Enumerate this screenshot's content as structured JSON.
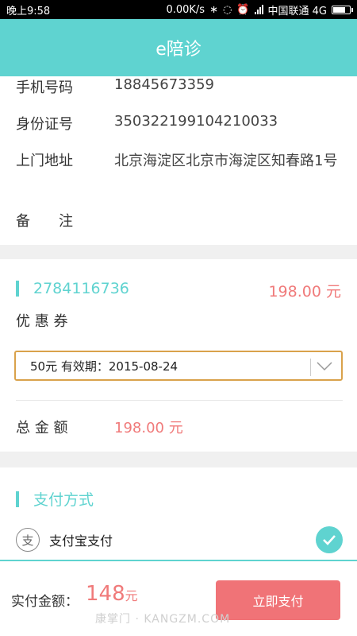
{
  "status_bar": {
    "time": "晚上9:58",
    "speed": "0.00K/s",
    "carrier": "中国联通 4G",
    "battery_level": 0.8
  },
  "header": {
    "title": "e陪诊"
  },
  "patient": {
    "phone_label": "手机号码",
    "phone_value": "18845673359",
    "id_label": "身份证号",
    "id_value": "350322199104210033",
    "address_label": "上门地址",
    "address_value": "北京海淀区北京市海淀区知春路1号",
    "remark_label": "备　　注"
  },
  "order": {
    "order_id": "2784116736",
    "price": "198.00 元",
    "coupon_label": "优 惠 券",
    "coupon_selected": "50元 有效期：2015-08-24",
    "total_label": "总 金 额",
    "total_value": "198.00 元"
  },
  "payment": {
    "section_title": "支付方式",
    "method_label": "支付宝支付",
    "method_icon": "alipay-icon",
    "method_selected": true
  },
  "footer": {
    "actual_label": "实付金额：",
    "actual_amount": "148",
    "actual_unit": "元",
    "pay_button": "立即支付",
    "watermark": "康掌门 · KANGZM.COM"
  },
  "colors": {
    "accent": "#5fd3d0",
    "price": "#f07a7a",
    "pay_button": "#f07377",
    "select_border": "#d9a24b"
  }
}
